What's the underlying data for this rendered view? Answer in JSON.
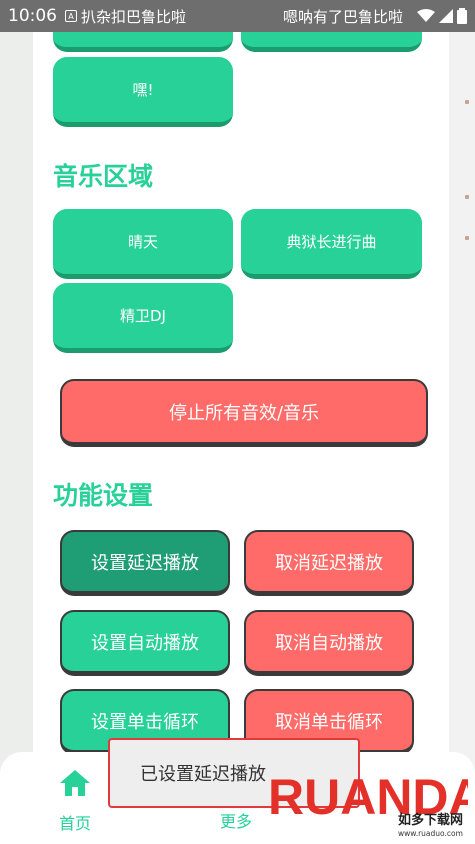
{
  "status": {
    "time": "10:06",
    "notification_left": "扒杂扣巴鲁比啦",
    "notification_right": "嗯呐有了巴鲁比啦"
  },
  "top_partial_buttons": [
    "",
    ""
  ],
  "hey_button": "嘿!",
  "music_section": {
    "title": "音乐区域",
    "buttons": [
      "晴天",
      "典狱长进行曲",
      "精卫DJ"
    ]
  },
  "stop_all_button": "停止所有音效/音乐",
  "settings_section": {
    "title": "功能设置",
    "set_delay": "设置延迟播放",
    "cancel_delay": "取消延迟播放",
    "set_auto": "设置自动播放",
    "cancel_auto": "取消自动播放",
    "set_loop": "设置单击循环",
    "cancel_loop": "取消单击循环"
  },
  "nav": {
    "home": "首页",
    "more": "更多"
  },
  "toast": "已设置延迟播放",
  "watermark": {
    "brand": "RUANDADUO",
    "cn": "如多下载网",
    "url": "www.ruaduo.com"
  },
  "colors": {
    "accent_green": "#27d198",
    "danger_red": "#ff6b68"
  }
}
